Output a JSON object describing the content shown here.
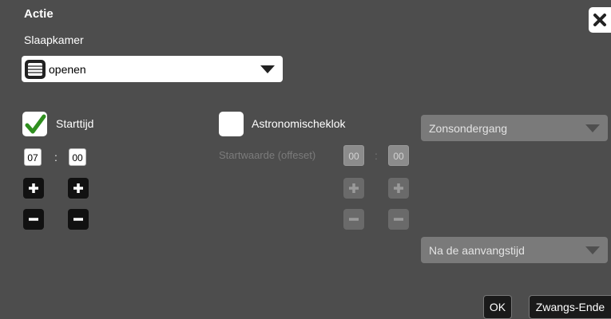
{
  "dialog": {
    "title": "Actie",
    "room": "Slaapkamer",
    "action_select": {
      "value": "openen"
    }
  },
  "start_time": {
    "checkbox_label": "Starttijd",
    "checked": true,
    "hours": "07",
    "separator": ":",
    "minutes": "00"
  },
  "astro": {
    "checkbox_label": "Astronomischeklok",
    "checked": false,
    "offset_label": "Startwaarde (offeset)",
    "hours": "00",
    "separator": ":",
    "minutes": "00",
    "sun_select": "Zonsondergang",
    "time_select": "Na de aanvangstijd"
  },
  "footer": {
    "ok_label": "OK",
    "force_end_label": "Zwangs-Ende"
  },
  "colors": {
    "background": "#4d4d4d",
    "check_green": "#2f8f1f"
  }
}
